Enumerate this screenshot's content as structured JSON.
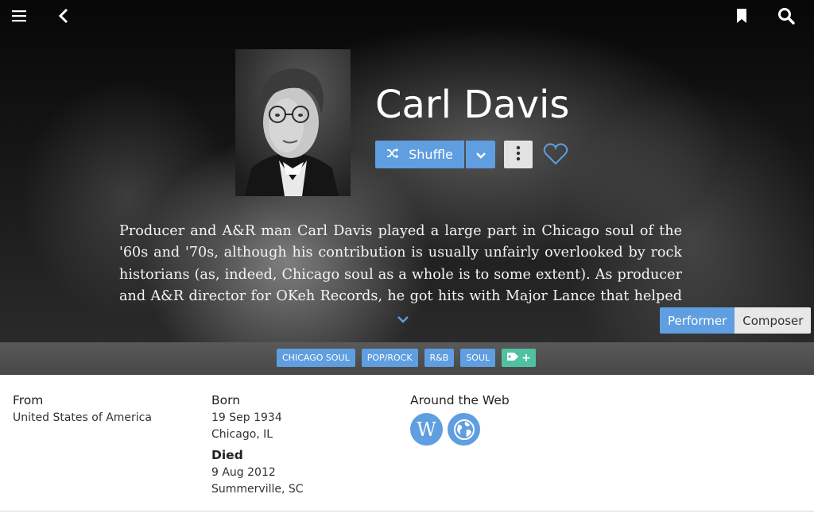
{
  "toolbar": {
    "menu_icon": "hamburger-menu-icon",
    "back_icon": "chevron-left-icon",
    "bookmark_icon": "bookmark-icon",
    "search_icon": "search-icon"
  },
  "artist": {
    "name": "Carl Davis",
    "photo_icon": "artist-portrait"
  },
  "actions": {
    "shuffle_label": "Shuffle",
    "shuffle_icon": "shuffle-icon",
    "dropdown_icon": "chevron-down-icon",
    "more_icon": "vertical-dots-icon",
    "favorite_icon": "heart-outline-icon"
  },
  "bio": {
    "text": "Producer and A&R man Carl Davis played a large part in Chicago soul of the '60s and '70s, although his contribution is usually unfairly overlooked by rock historians (as, indeed, Chicago soul as a whole is to some extent). As producer and A&R director for OKeh Records, he got hits with Major Lance that helped define",
    "expand_icon": "chevron-down-icon"
  },
  "roles": {
    "performer": "Performer",
    "composer": "Composer",
    "selected": "Performer"
  },
  "tags": [
    "CHICAGO SOUL",
    "POP/ROCK",
    "R&B",
    "SOUL"
  ],
  "add_tag_icon": "tag-plus-icon",
  "details": {
    "from_label": "From",
    "from_value": "United States of America",
    "born_label": "Born",
    "born_date": "19 Sep 1934",
    "born_place": "Chicago, IL",
    "died_label": "Died",
    "died_date": "9 Aug 2012",
    "died_place": "Summerville, SC",
    "web_label": "Around the Web",
    "wikipedia_letter": "W",
    "wikipedia_icon": "wikipedia-icon",
    "website_icon": "globe-icon"
  },
  "colors": {
    "accent": "#5f9ee0",
    "tag_add": "#4fc1a2",
    "hero_bg": "#111111"
  }
}
